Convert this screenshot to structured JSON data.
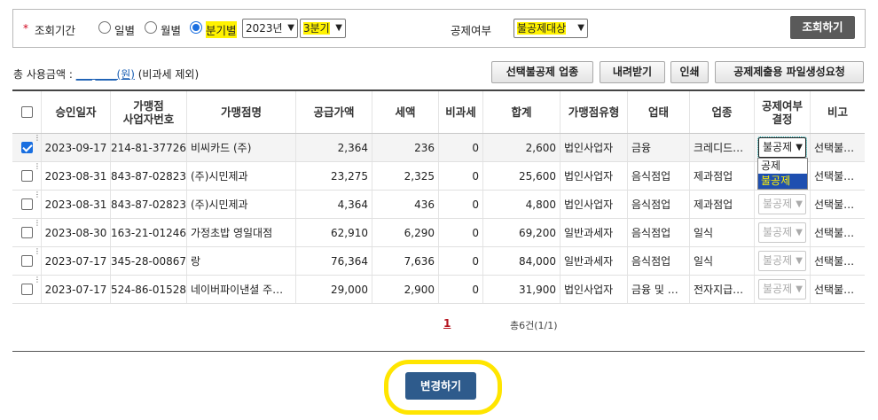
{
  "search": {
    "required_mark": "*",
    "period_label": "조회기간",
    "radios": [
      {
        "label": "일별",
        "checked": false
      },
      {
        "label": "월별",
        "checked": false
      },
      {
        "label": "분기별",
        "checked": true
      }
    ],
    "year_value": "2023년",
    "quarter_value": "3분기",
    "deduction_label": "공제여부",
    "deduction_value": "불공제대상",
    "search_button": "조회하기"
  },
  "summary": {
    "prefix": "총 사용금액 :",
    "amount": "___ ____(원)",
    "suffix": "(비과세 제외)"
  },
  "toolbar": {
    "buttons": [
      "선택불공제 업종",
      "내려받기",
      "인쇄",
      "공제제출용 파일생성요청"
    ]
  },
  "table": {
    "headers": [
      "승인일자",
      "가맹점\n사업자번호",
      "가맹점명",
      "공급가액",
      "세액",
      "비과세",
      "합계",
      "가맹점유형",
      "업태",
      "업종",
      "공제여부\n결정",
      "비고"
    ],
    "rows": [
      {
        "checked": true,
        "date": "2023-09-17",
        "biz_no": "214-81-37726",
        "name": "비씨카드 (주)",
        "supply": "2,364",
        "tax": "236",
        "nontax": "0",
        "total": "2,600",
        "type": "법인사업자",
        "biz_type": "금융",
        "category": "크레디드카드",
        "decision": "불공제",
        "note": "선택불공제"
      },
      {
        "checked": false,
        "date": "2023-08-31",
        "biz_no": "843-87-02823",
        "name": "(주)시민제과",
        "supply": "23,275",
        "tax": "2,325",
        "nontax": "0",
        "total": "25,600",
        "type": "법인사업자",
        "biz_type": "음식점업",
        "category": "제과점업",
        "decision": "",
        "note": "선택불공제"
      },
      {
        "checked": false,
        "date": "2023-08-31",
        "biz_no": "843-87-02823",
        "name": "(주)시민제과",
        "supply": "4,364",
        "tax": "436",
        "nontax": "0",
        "total": "4,800",
        "type": "법인사업자",
        "biz_type": "음식점업",
        "category": "제과점업",
        "decision": "불공제",
        "note": "선택불공제"
      },
      {
        "checked": false,
        "date": "2023-08-30",
        "biz_no": "163-21-01246",
        "name": "가정초밥 영일대점",
        "supply": "62,910",
        "tax": "6,290",
        "nontax": "0",
        "total": "69,200",
        "type": "일반과세자",
        "biz_type": "음식점업",
        "category": "일식",
        "decision": "불공제",
        "note": "선택불공제"
      },
      {
        "checked": false,
        "date": "2023-07-17",
        "biz_no": "345-28-00867",
        "name": "랑",
        "supply": "76,364",
        "tax": "7,636",
        "nontax": "0",
        "total": "84,000",
        "type": "일반과세자",
        "biz_type": "음식점업",
        "category": "일식",
        "decision": "불공제",
        "note": "선택불공제"
      },
      {
        "checked": false,
        "date": "2023-07-17",
        "biz_no": "524-86-01528",
        "name": "네이버파이낸셜 주식회사",
        "supply": "29,000",
        "tax": "2,900",
        "nontax": "0",
        "total": "31,900",
        "type": "법인사업자",
        "biz_type": "금융 및 보험업",
        "category": "전자지급결제",
        "decision": "불공제",
        "note": "선택불공제"
      }
    ]
  },
  "dropdown_options": [
    "공제",
    "불공제"
  ],
  "pager": {
    "current": "1",
    "count_text": "총6건(1/1)"
  },
  "change_button": "변경하기",
  "colors": {
    "highlight": "#fff200",
    "primary_button": "#2e5b8c",
    "search_button": "#5a5a5a",
    "accent_ring": "#ffe500"
  }
}
